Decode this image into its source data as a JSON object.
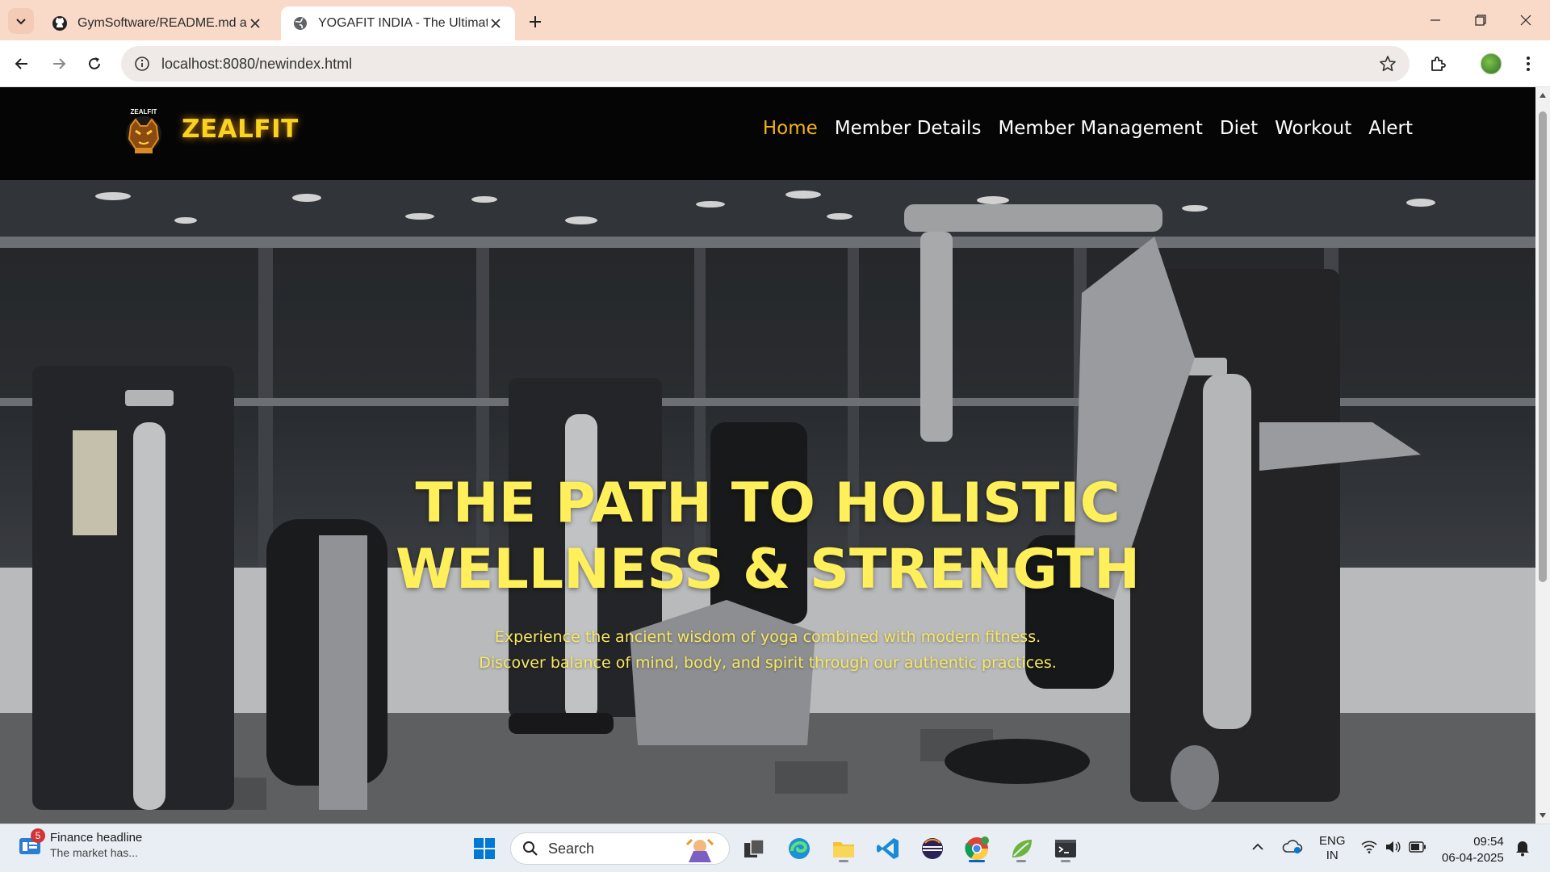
{
  "browser": {
    "tabs": [
      {
        "title": "GymSoftware/README.md at m",
        "favicon": "github-icon",
        "active": false
      },
      {
        "title": "YOGAFIT INDIA - The Ultimate Y",
        "favicon": "globe-icon",
        "active": true
      }
    ],
    "url": "localhost:8080/newindex.html"
  },
  "site": {
    "brand": "ZEALFIT",
    "logo_text": "ZEALFIT",
    "nav": [
      {
        "label": "Home",
        "active": true
      },
      {
        "label": "Member Details",
        "active": false
      },
      {
        "label": "Member Management",
        "active": false
      },
      {
        "label": "Diet",
        "active": false
      },
      {
        "label": "Workout",
        "active": false
      },
      {
        "label": "Alert",
        "active": false
      }
    ],
    "hero": {
      "title_line1": "THE PATH TO HOLISTIC",
      "title_line2": "WELLNESS & STRENGTH",
      "subtitle_line1": "Experience the ancient wisdom of yoga combined with modern fitness.",
      "subtitle_line2": "Discover balance of mind, body, and spirit through our authentic practices."
    },
    "colors": {
      "brand": "#f9d31f",
      "nav_active": "#f6b312",
      "hero_text": "#ffef5a"
    }
  },
  "taskbar": {
    "news_badge": "5",
    "news_headline": "Finance headline",
    "news_sub": "The market has...",
    "search_label": "Search",
    "lang_line1": "ENG",
    "lang_line2": "IN",
    "time": "09:54",
    "date": "06-04-2025"
  }
}
